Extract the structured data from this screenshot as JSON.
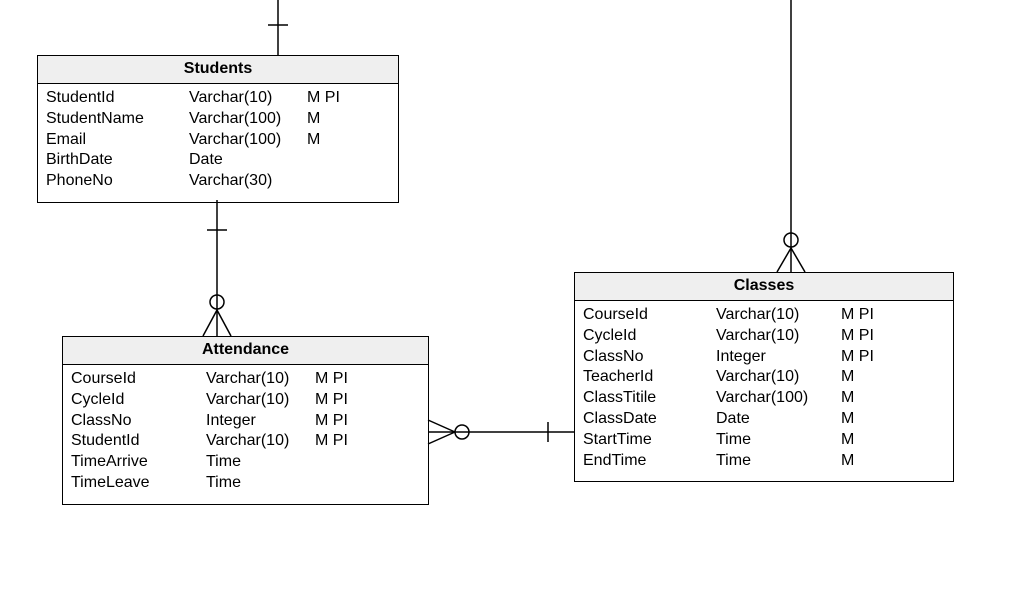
{
  "entities": {
    "students": {
      "title": "Students",
      "columns": [
        {
          "name": "StudentId",
          "type": "Varchar(10)",
          "flag": "M PI"
        },
        {
          "name": "StudentName",
          "type": "Varchar(100)",
          "flag": "M"
        },
        {
          "name": "Email",
          "type": "Varchar(100)",
          "flag": "M"
        },
        {
          "name": "BirthDate",
          "type": "Date",
          "flag": ""
        },
        {
          "name": "PhoneNo",
          "type": "Varchar(30)",
          "flag": ""
        }
      ]
    },
    "attendance": {
      "title": "Attendance",
      "columns": [
        {
          "name": "CourseId",
          "type": "Varchar(10)",
          "flag": "M PI"
        },
        {
          "name": "CycleId",
          "type": "Varchar(10)",
          "flag": "M PI"
        },
        {
          "name": "ClassNo",
          "type": "Integer",
          "flag": "M PI"
        },
        {
          "name": "StudentId",
          "type": "Varchar(10)",
          "flag": "M PI"
        },
        {
          "name": "TimeArrive",
          "type": "Time",
          "flag": ""
        },
        {
          "name": "TimeLeave",
          "type": "Time",
          "flag": ""
        }
      ]
    },
    "classes": {
      "title": "Classes",
      "columns": [
        {
          "name": "CourseId",
          "type": "Varchar(10)",
          "flag": "M PI"
        },
        {
          "name": "CycleId",
          "type": "Varchar(10)",
          "flag": "M PI"
        },
        {
          "name": "ClassNo",
          "type": "Integer",
          "flag": "M PI"
        },
        {
          "name": "TeacherId",
          "type": "Varchar(10)",
          "flag": "M"
        },
        {
          "name": "ClassTitile",
          "type": "Varchar(100)",
          "flag": "M"
        },
        {
          "name": "ClassDate",
          "type": "Date",
          "flag": "M"
        },
        {
          "name": "StartTime",
          "type": "Time",
          "flag": "M"
        },
        {
          "name": "EndTime",
          "type": "Time",
          "flag": "M"
        }
      ]
    }
  }
}
